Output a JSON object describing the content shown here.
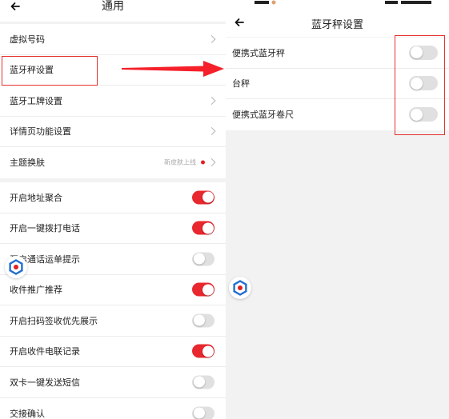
{
  "left": {
    "title": "通用",
    "group1": [
      {
        "label": "虚拟号码",
        "chevron": true
      },
      {
        "label": "蓝牙秤设置",
        "chevron": true
      },
      {
        "label": "蓝牙工牌设置",
        "chevron": true
      },
      {
        "label": "详情页功能设置",
        "chevron": true
      },
      {
        "label": "主题换肤",
        "chevron": true,
        "extra": "新皮肤上线",
        "dot": true
      }
    ],
    "group2": [
      {
        "label": "开启地址聚合",
        "on": true
      },
      {
        "label": "开启一键拨打电话",
        "on": true
      },
      {
        "label": "开启通话运单提示",
        "on": false
      },
      {
        "label": "收件推广推荐",
        "on": true
      },
      {
        "label": "开启扫码签收优先展示",
        "on": false
      },
      {
        "label": "开启收件电联记录",
        "on": true
      },
      {
        "label": "双卡一键发送短信",
        "on": false
      },
      {
        "label": "交接确认",
        "on": false
      }
    ]
  },
  "right": {
    "title": "蓝牙秤设置",
    "items": [
      {
        "label": "便携式蓝牙秤",
        "on": false
      },
      {
        "label": "台秤",
        "on": false
      },
      {
        "label": "便携式蓝牙卷尺",
        "on": false
      }
    ]
  },
  "colors": {
    "toggle_on": "#e8282e",
    "toggle_off": "#e0e0e0",
    "annotation_red": "#e5322d",
    "float_icon_blue": "#1f6fd1"
  },
  "icons": {
    "back": "arrow-left-icon",
    "chevron": "chevron-right-icon",
    "float": "hexagon-logo-icon"
  }
}
